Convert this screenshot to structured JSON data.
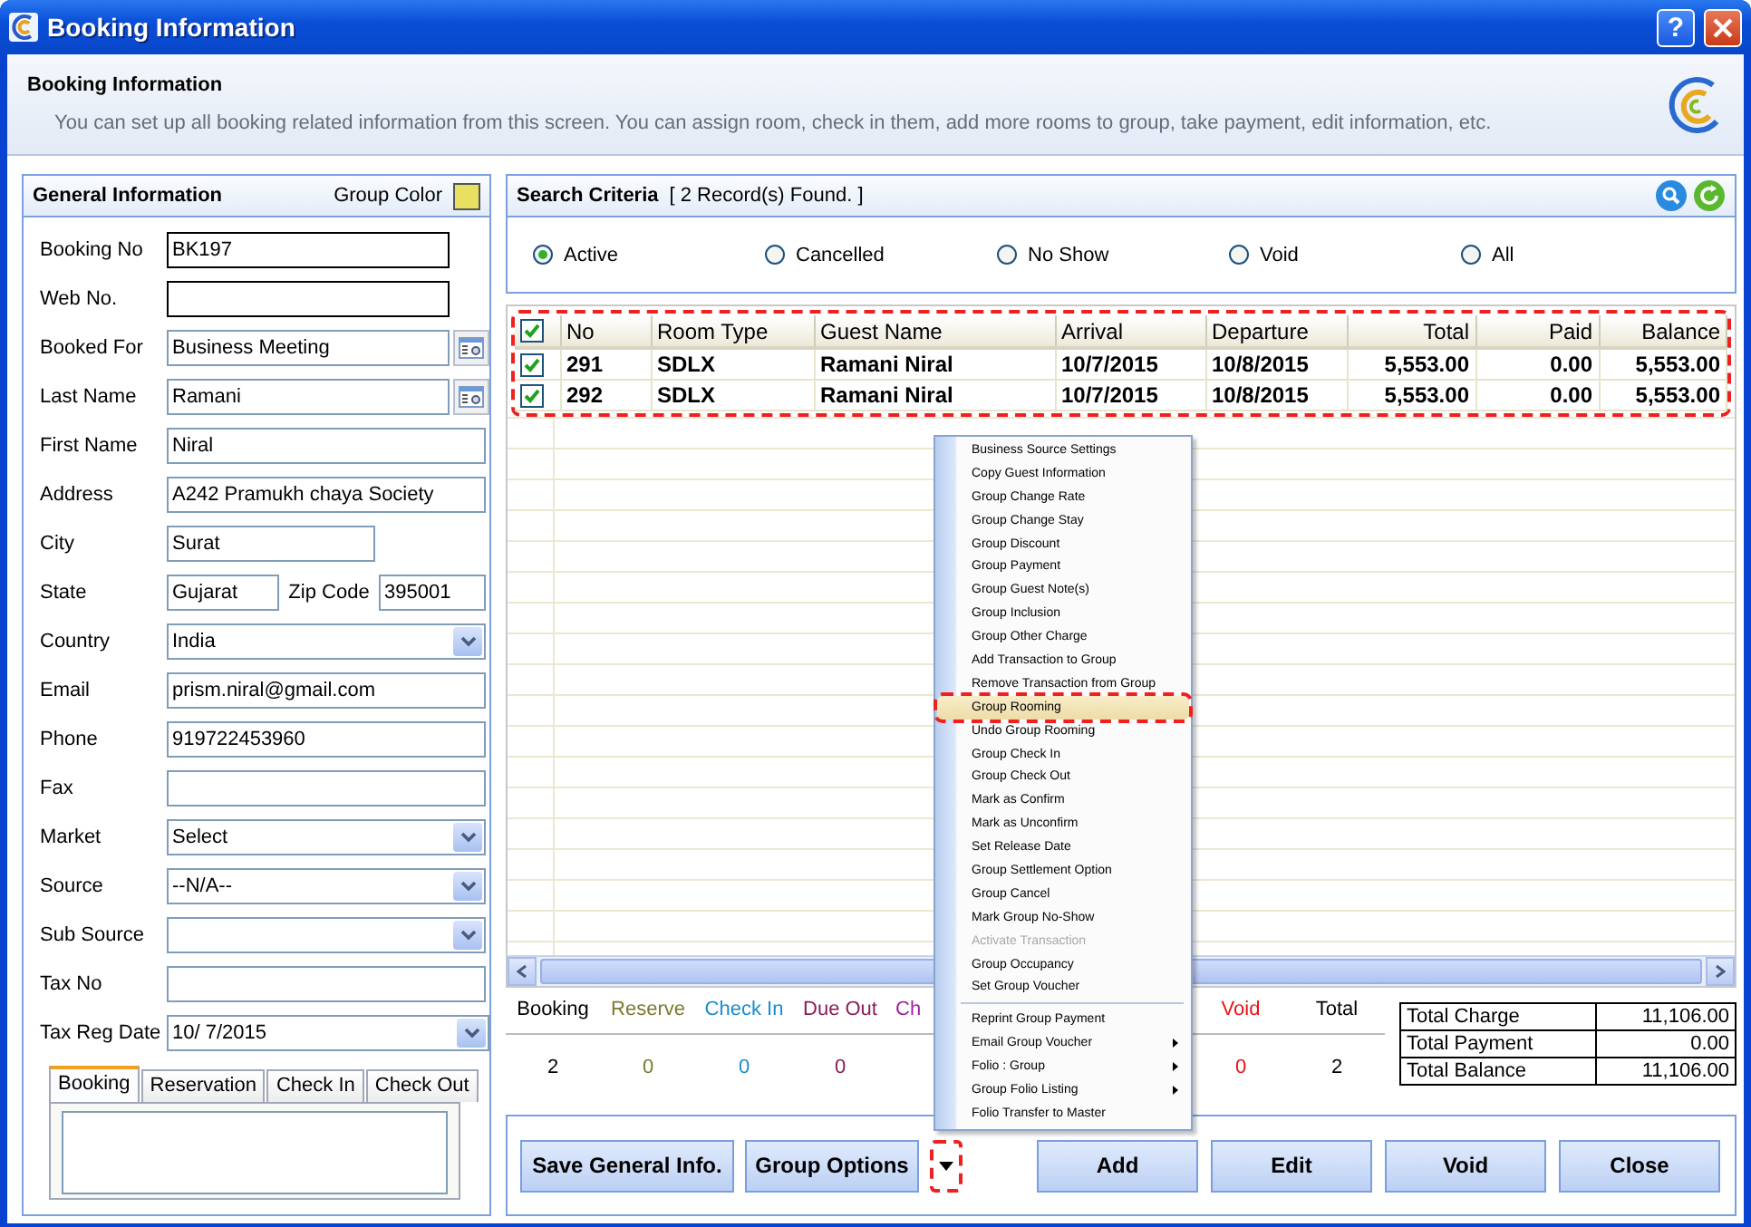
{
  "window": {
    "title": "Booking Information",
    "help": "?"
  },
  "header": {
    "title": "Booking Information",
    "description": "You can set up all booking related information from this screen. You can assign room, check in them, add more rooms to group, take payment, edit information, etc."
  },
  "general": {
    "title": "General Information",
    "group_color_label": "Group Color",
    "fields": [
      {
        "kind": "code",
        "label": "Booking No",
        "value": "BK197"
      },
      {
        "kind": "code",
        "label": "Web No."
      },
      {
        "kind": "lookup",
        "label": "Booked For",
        "value": "Business Meeting"
      },
      {
        "kind": "lookup",
        "label": "Last Name",
        "value": "Ramani"
      },
      {
        "kind": "text",
        "label": "First Name",
        "value": "Niral"
      },
      {
        "kind": "text",
        "label": "Address",
        "value": "A242 Pramukh chaya Society"
      },
      {
        "kind": "short",
        "label": "City",
        "value": "Surat"
      },
      {
        "kind": "pair",
        "label": "State",
        "value": "Gujarat",
        "label2": "Zip Code",
        "value2": "395001"
      },
      {
        "kind": "select",
        "label": "Country",
        "value": "India"
      },
      {
        "kind": "text",
        "label": "Email",
        "value": "prism.niral@gmail.com"
      },
      {
        "kind": "text",
        "label": "Phone",
        "value": "919722453960"
      },
      {
        "kind": "text",
        "label": "Fax"
      },
      {
        "kind": "select",
        "label": "Market",
        "value": "Select"
      },
      {
        "kind": "select",
        "label": "Source",
        "value": "--N/A--"
      },
      {
        "kind": "select",
        "label": "Sub Source"
      },
      {
        "kind": "text",
        "label": "Tax No"
      },
      {
        "kind": "date",
        "label": "Tax Reg Date",
        "value": "10/  7/2015"
      }
    ],
    "tabs": [
      {
        "label": "Booking",
        "selected": true
      },
      {
        "label": "Reservation",
        "selected": false
      },
      {
        "label": "Check In",
        "selected": false
      },
      {
        "label": "Check Out",
        "selected": false
      }
    ]
  },
  "search": {
    "title": "Search Criteria",
    "records": "[ 2 Record(s) Found. ]",
    "options": [
      {
        "label": "Active",
        "selected": true
      },
      {
        "label": "Cancelled",
        "selected": false
      },
      {
        "label": "No Show",
        "selected": false
      },
      {
        "label": "Void",
        "selected": false
      },
      {
        "label": "All",
        "selected": false
      }
    ]
  },
  "table": {
    "highlighted": true,
    "all_checked": true,
    "columns": [
      {
        "label": "No",
        "kind": "text"
      },
      {
        "label": "Room Type",
        "kind": "text"
      },
      {
        "label": "Guest Name",
        "kind": "text"
      },
      {
        "label": "Arrival",
        "kind": "text"
      },
      {
        "label": "Departure",
        "kind": "text"
      },
      {
        "label": "Total",
        "kind": "number"
      },
      {
        "label": "Paid",
        "kind": "number"
      },
      {
        "label": "Balance",
        "kind": "number"
      }
    ],
    "rows": [
      {
        "checked": true,
        "cells": [
          "291",
          "SDLX",
          "Ramani Niral",
          "10/7/2015",
          "10/8/2015",
          "5,553.00",
          "0.00",
          "5,553.00"
        ]
      },
      {
        "checked": true,
        "cells": [
          "292",
          "SDLX",
          "Ramani Niral",
          "10/7/2015",
          "10/8/2015",
          "5,553.00",
          "0.00",
          "5,553.00"
        ]
      }
    ]
  },
  "status_counts": [
    {
      "label": "Booking",
      "value": "2",
      "color": "#000000"
    },
    {
      "label": "Reserve",
      "value": "0",
      "color": "#7a7a30"
    },
    {
      "label": "Check In",
      "value": "0",
      "color": "#1a8ccc"
    },
    {
      "label": "Due Out",
      "value": "0",
      "color": "#8b1a5a"
    },
    {
      "label": "Ch",
      "color": "#a020a0"
    }
  ],
  "status_counts_right": [
    {
      "label": "Void",
      "value": "0",
      "color": "#ee1111"
    },
    {
      "label": "Total",
      "value": "2",
      "color": "#000000"
    }
  ],
  "totals": [
    {
      "label": "Total Charge",
      "value": "11,106.00"
    },
    {
      "label": "Total Payment",
      "value": "0.00"
    },
    {
      "label": "Total Balance",
      "value": "11,106.00"
    }
  ],
  "buttons": {
    "save": "Save General Info.",
    "group_options": "Group Options",
    "group_options_arrow_highlighted": true,
    "actions": [
      "Add",
      "Edit",
      "Void",
      "Close"
    ]
  },
  "menu": [
    {
      "label": "Business Source Settings",
      "selected": false,
      "disabled": false,
      "submenu": false
    },
    {
      "label": "Copy Guest Information",
      "selected": false,
      "disabled": false,
      "submenu": false
    },
    {
      "label": "Group Change Rate",
      "selected": false,
      "disabled": false,
      "submenu": false
    },
    {
      "label": "Group Change Stay",
      "selected": false,
      "disabled": false,
      "submenu": false
    },
    {
      "label": "Group Discount",
      "selected": false,
      "disabled": false,
      "submenu": false
    },
    {
      "label": "Group Payment",
      "selected": false,
      "disabled": false,
      "submenu": false
    },
    {
      "label": "Group Guest Note(s)",
      "selected": false,
      "disabled": false,
      "submenu": false
    },
    {
      "label": "Group Inclusion",
      "selected": false,
      "disabled": false,
      "submenu": false
    },
    {
      "label": "Group Other Charge",
      "selected": false,
      "disabled": false,
      "submenu": false
    },
    {
      "label": "Add Transaction to Group",
      "selected": false,
      "disabled": false,
      "submenu": false
    },
    {
      "label": "Remove Transaction from Group",
      "selected": false,
      "disabled": false,
      "submenu": false
    },
    {
      "label": "Group Rooming",
      "selected": true,
      "disabled": false,
      "submenu": false
    },
    {
      "label": "Undo Group Rooming",
      "selected": false,
      "disabled": false,
      "submenu": false
    },
    {
      "label": "Group Check In",
      "selected": false,
      "disabled": false,
      "submenu": false
    },
    {
      "label": "Group Check Out",
      "selected": false,
      "disabled": false,
      "submenu": false
    },
    {
      "label": "Mark as Confirm",
      "selected": false,
      "disabled": false,
      "submenu": false
    },
    {
      "label": "Mark as Unconfirm",
      "selected": false,
      "disabled": false,
      "submenu": false
    },
    {
      "label": "Set Release Date",
      "selected": false,
      "disabled": false,
      "submenu": false
    },
    {
      "label": "Group Settlement Option",
      "selected": false,
      "disabled": false,
      "submenu": false
    },
    {
      "label": "Group Cancel",
      "selected": false,
      "disabled": false,
      "submenu": false
    },
    {
      "label": "Mark Group No-Show",
      "selected": false,
      "disabled": false,
      "submenu": false
    },
    {
      "label": "Activate Transaction",
      "selected": false,
      "disabled": true,
      "submenu": false
    },
    {
      "label": "Group Occupancy",
      "selected": false,
      "disabled": false,
      "submenu": false
    },
    {
      "label": "Set Group Voucher",
      "selected": false,
      "disabled": false,
      "submenu": false
    },
    {
      "label": "Reprint Group Payment",
      "selected": false,
      "disabled": false,
      "submenu": false,
      "separator_before": true
    },
    {
      "label": "Email Group Voucher",
      "selected": false,
      "disabled": false,
      "submenu": true
    },
    {
      "label": "Folio : Group",
      "selected": false,
      "disabled": false,
      "submenu": true
    },
    {
      "label": "Group Folio Listing",
      "selected": false,
      "disabled": false,
      "submenu": true
    },
    {
      "label": "Folio Transfer to Master",
      "selected": false,
      "disabled": false,
      "submenu": false
    }
  ]
}
